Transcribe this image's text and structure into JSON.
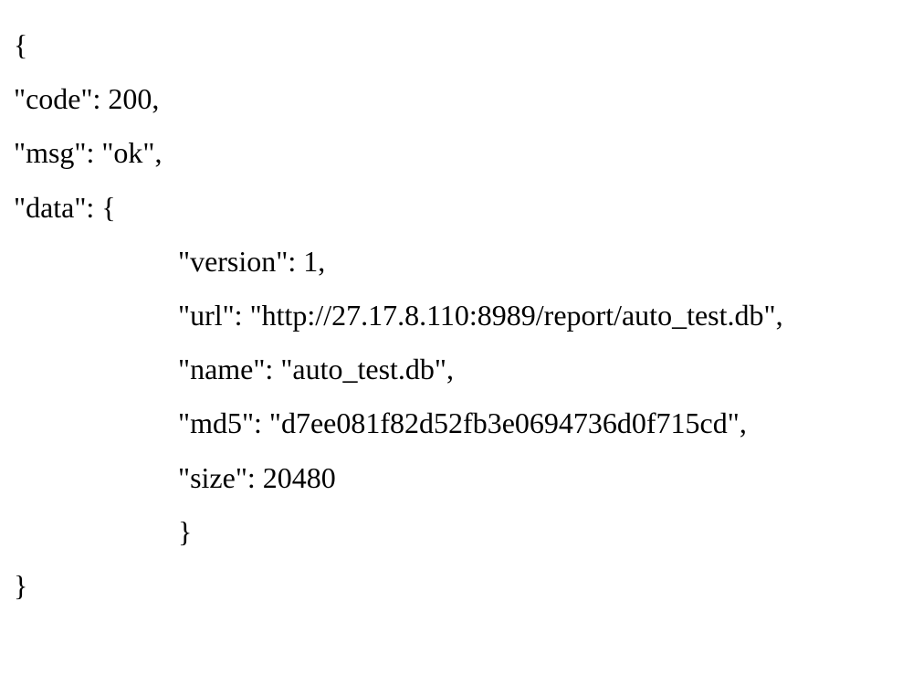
{
  "lines": {
    "l0": "{",
    "l1": "\"code\": 200,",
    "l2": "\"msg\": \"ok\",",
    "l3": "\"data\": {",
    "l4": "\"version\": 1,",
    "l5": "\"url\": \"http://27.17.8.110:8989/report/auto_test.db\",",
    "l6": "\"name\": \"auto_test.db\",",
    "l7": "\"md5\": \"d7ee081f82d52fb3e0694736d0f715cd\",",
    "l8": "\"size\": 20480",
    "l9": "}",
    "l10": "}"
  }
}
